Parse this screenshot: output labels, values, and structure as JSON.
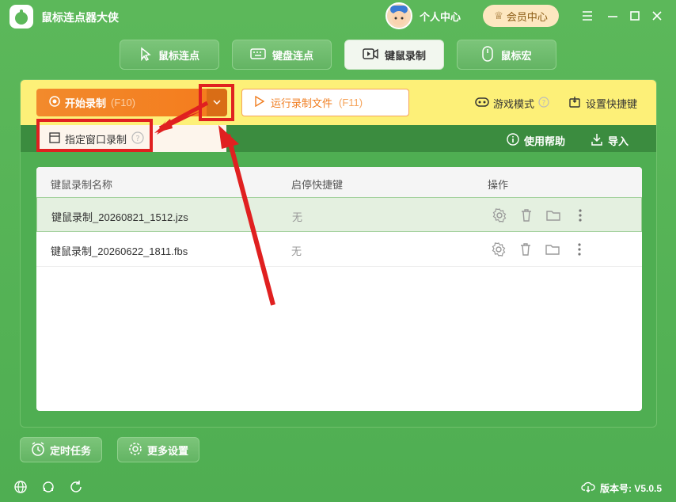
{
  "app": {
    "title": "鼠标连点器大侠"
  },
  "header": {
    "personal_center": "个人中心",
    "vip_center": "会员中心"
  },
  "tabs": [
    {
      "label": "鼠标连点"
    },
    {
      "label": "键盘连点"
    },
    {
      "label": "键鼠录制"
    },
    {
      "label": "鼠标宏"
    }
  ],
  "toolbar": {
    "start_label": "开始录制",
    "start_key": "(F10)",
    "run_label": "运行录制文件",
    "run_key": "(F11)",
    "game_mode": "游戏模式",
    "set_hotkey": "设置快捷键"
  },
  "dropdown": {
    "window_record": "指定窗口录制"
  },
  "subbar": {
    "help": "使用帮助",
    "import": "导入"
  },
  "table": {
    "headers": [
      "键鼠录制名称",
      "启停快捷键",
      "操作"
    ],
    "rows": [
      {
        "name": "键鼠录制_20260821_1512.jzs",
        "hotkey": "无"
      },
      {
        "name": "键鼠录制_20260622_1811.fbs",
        "hotkey": "无"
      }
    ]
  },
  "bottom": {
    "timer_task": "定时任务",
    "more_settings": "更多设置"
  },
  "footer": {
    "version": "版本号: V5.0.5"
  },
  "colors": {
    "brand_green": "#4fae52",
    "accent_orange": "#f28a2c",
    "annotation_red": "#e02020"
  }
}
